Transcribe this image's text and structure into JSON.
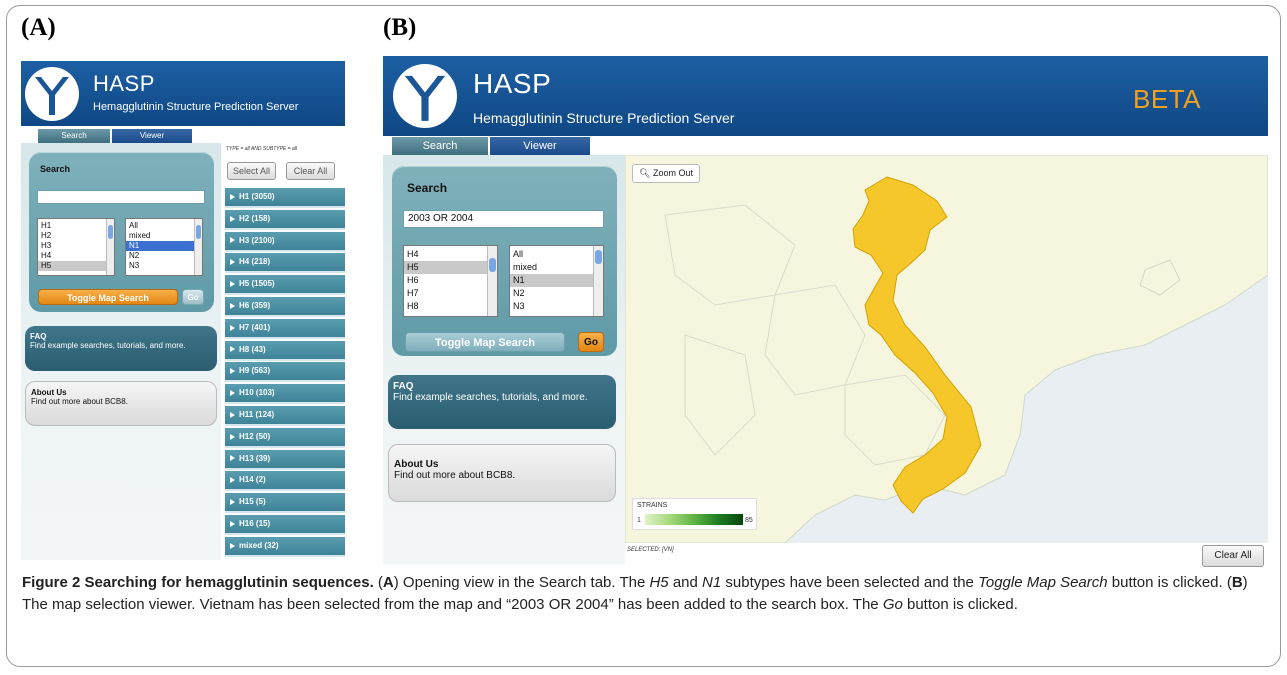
{
  "panel_a_label": "(A)",
  "panel_b_label": "(B)",
  "app": {
    "title": "HASP",
    "subtitle": "Hemagglutinin Structure Prediction Server",
    "beta": "BETA"
  },
  "tabs": {
    "search": "Search",
    "viewer": "Viewer"
  },
  "panel_a": {
    "search_label": "Search",
    "search_value": "",
    "h_list": [
      "H1",
      "H2",
      "H3",
      "H4",
      "H5"
    ],
    "h_selected": "H5",
    "n_list": [
      "All",
      "mixed",
      "N1",
      "N2",
      "N3"
    ],
    "n_selected": "N1",
    "toggle_label": "Toggle Map Search",
    "go_label": "Go",
    "faq_title": "FAQ",
    "faq_text": "Find example searches, tutorials, and more.",
    "about_title": "About Us",
    "about_text": "Find out more about BCB8.",
    "filter_text": "TYPE = all AND SUBTYPE = all",
    "select_all": "Select All",
    "clear_all": "Clear All",
    "subtypes": [
      "H1 (3050)",
      "H2 (158)",
      "H3 (2100)",
      "H4 (218)",
      "H5 (1505)",
      "H6 (359)",
      "H7 (401)",
      "H8 (43)",
      "H9 (563)",
      "H10 (103)",
      "H11 (124)",
      "H12 (50)",
      "H13 (39)",
      "H14 (2)",
      "H15 (5)",
      "H16 (15)",
      "mixed (32)"
    ]
  },
  "panel_b": {
    "search_label": "Search",
    "search_value": "2003 OR 2004",
    "h_list": [
      "H4",
      "H5",
      "H6",
      "H7",
      "H8"
    ],
    "h_selected": "H5",
    "n_list": [
      "All",
      "mixed",
      "N1",
      "N2",
      "N3"
    ],
    "n_selected": "N1",
    "toggle_label": "Toggle Map Search",
    "go_label": "Go",
    "faq_title": "FAQ",
    "faq_text": "Find example searches, tutorials, and more.",
    "about_title": "About Us",
    "about_text": "Find out more about BCB8.",
    "zoom_out": "Zoom Out",
    "legend_title": "STRAINS",
    "legend_min": "1",
    "legend_max": "85",
    "selected_text": "SELECTED: [VN]",
    "clear_all": "Clear All"
  },
  "colors": {
    "header": "#1a5596",
    "beta": "#f0a020",
    "highlight_country": "#f5c72a",
    "land": "#f6f6df"
  },
  "caption": {
    "fig": "Figure 2 Searching for hemagglutinin sequences.",
    "a": "A",
    "a_text": ") Opening view in the Search tab. The ",
    "h5": "H5",
    "and": " and ",
    "n1": "N1",
    "a_text2": " subtypes have been selected and the ",
    "toggle": "Toggle Map Search",
    "a_text3": " button is clicked. (",
    "b": "B",
    "b_text": ") The map selection viewer. Vietnam has been selected from the map and “2003 OR 2004” has been added to the search box. The ",
    "go": "Go",
    "b_text2": " button is clicked."
  }
}
